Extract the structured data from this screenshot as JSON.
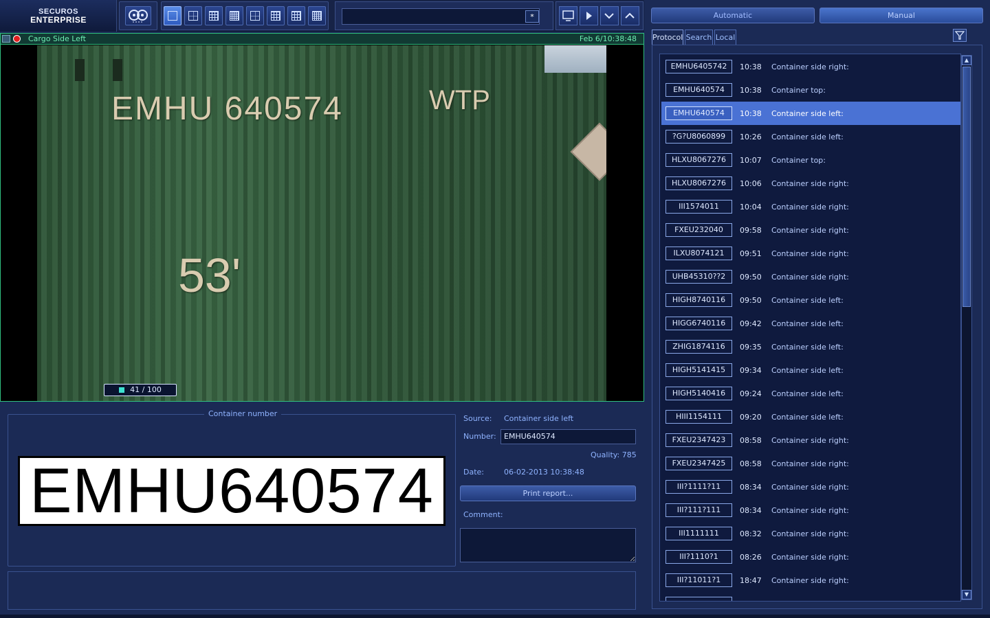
{
  "logo": {
    "line1": "SECUROS",
    "line2": "ENTERPRISE"
  },
  "toolbar": {
    "search_value": "",
    "search_star": "*"
  },
  "video": {
    "title": "Cargo Side Left",
    "datetime": "Feb 6/10:38:48",
    "frame_counter": "41 / 100",
    "frame_current": 41,
    "frame_total": 100
  },
  "scene": {
    "container_text": "EMHU 640574",
    "side_text": "WTP",
    "size_text": "53'"
  },
  "container_panel": {
    "legend": "Container number",
    "plate": "EMHU640574",
    "source_label": "Source:",
    "source_value": "Container side left",
    "number_label": "Number:",
    "number_value": "EMHU640574",
    "quality": "Quality: 785",
    "date_label": "Date:",
    "date_value": "06-02-2013 10:38:48",
    "print_label": "Print report...",
    "comment_label": "Comment:"
  },
  "right": {
    "automatic_label": "Automatic",
    "manual_label": "Manual",
    "tabs": [
      "Protocol",
      "Search",
      "Local"
    ],
    "rows": [
      {
        "num": "EMHU6405742",
        "time": "10:38",
        "src": "Container side right:"
      },
      {
        "num": "EMHU640574",
        "time": "10:38",
        "src": "Container top:"
      },
      {
        "num": "EMHU640574",
        "time": "10:38",
        "src": "Container side left:"
      },
      {
        "num": "?G?U8060899",
        "time": "10:26",
        "src": "Container side left:"
      },
      {
        "num": "HLXU8067276",
        "time": "10:07",
        "src": "Container top:"
      },
      {
        "num": "HLXU8067276",
        "time": "10:06",
        "src": "Container side right:"
      },
      {
        "num": "III1574011",
        "time": "10:04",
        "src": "Container side right:"
      },
      {
        "num": "FXEU232040",
        "time": "09:58",
        "src": "Container side right:"
      },
      {
        "num": "ILXU8074121",
        "time": "09:51",
        "src": "Container side right:"
      },
      {
        "num": "UHB45310??2",
        "time": "09:50",
        "src": "Container side right:"
      },
      {
        "num": "HIGH8740116",
        "time": "09:50",
        "src": "Container side left:"
      },
      {
        "num": "HIGG6740116",
        "time": "09:42",
        "src": "Container side left:"
      },
      {
        "num": "ZHIG1874116",
        "time": "09:35",
        "src": "Container side left:"
      },
      {
        "num": "HIGH5141415",
        "time": "09:34",
        "src": "Container side left:"
      },
      {
        "num": "HIGH5140416",
        "time": "09:24",
        "src": "Container side left:"
      },
      {
        "num": "HIII1154111",
        "time": "09:20",
        "src": "Container side left:"
      },
      {
        "num": "FXEU2347423",
        "time": "08:58",
        "src": "Container side right:"
      },
      {
        "num": "FXEU2347425",
        "time": "08:58",
        "src": "Container side right:"
      },
      {
        "num": "III?1111?11",
        "time": "08:34",
        "src": "Container side right:"
      },
      {
        "num": "III?111?111",
        "time": "08:34",
        "src": "Container side right:"
      },
      {
        "num": "III1111111",
        "time": "08:32",
        "src": "Container side right:"
      },
      {
        "num": "III?1110?1",
        "time": "08:26",
        "src": "Container side right:"
      },
      {
        "num": "III?11011?1",
        "time": "18:47",
        "src": "Container side right:"
      }
    ],
    "selected_index": 2
  }
}
